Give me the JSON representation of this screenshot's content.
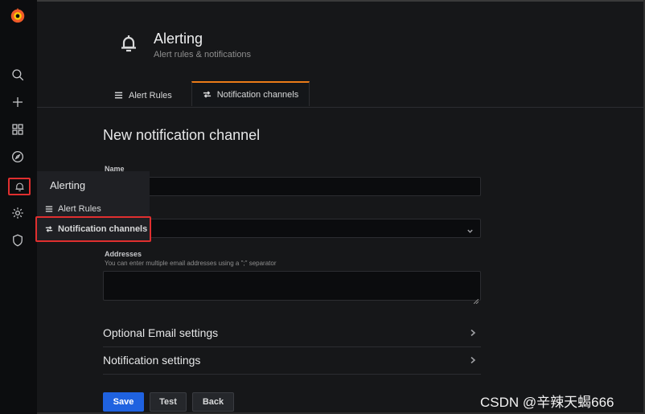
{
  "header": {
    "title": "Alerting",
    "subtitle": "Alert rules & notifications"
  },
  "tabs": [
    {
      "label": "Alert Rules",
      "active": false
    },
    {
      "label": "Notification channels",
      "active": true
    }
  ],
  "flyout": {
    "title": "Alerting",
    "items": [
      {
        "label": "Alert Rules"
      },
      {
        "label": "Notification channels"
      }
    ]
  },
  "form": {
    "heading": "New notification channel",
    "name_label": "Name",
    "name_value": "",
    "type_value": "",
    "addresses_label": "Addresses",
    "addresses_desc": "You can enter multiple email addresses using a \";\" separator",
    "addresses_value": ""
  },
  "sections": [
    {
      "label": "Optional Email settings"
    },
    {
      "label": "Notification settings"
    }
  ],
  "buttons": {
    "save": "Save",
    "test": "Test",
    "back": "Back"
  },
  "watermark": "CSDN @辛辣天蝎666",
  "sidebar_icons": [
    "grafana-logo-icon",
    "search-icon",
    "plus-icon",
    "dashboards-icon",
    "explore-icon",
    "bell-icon",
    "gear-icon",
    "shield-icon"
  ],
  "colors": {
    "accent": "#eb7b18",
    "primary_button": "#1f62e0",
    "highlight_box": "#e02f2f"
  }
}
